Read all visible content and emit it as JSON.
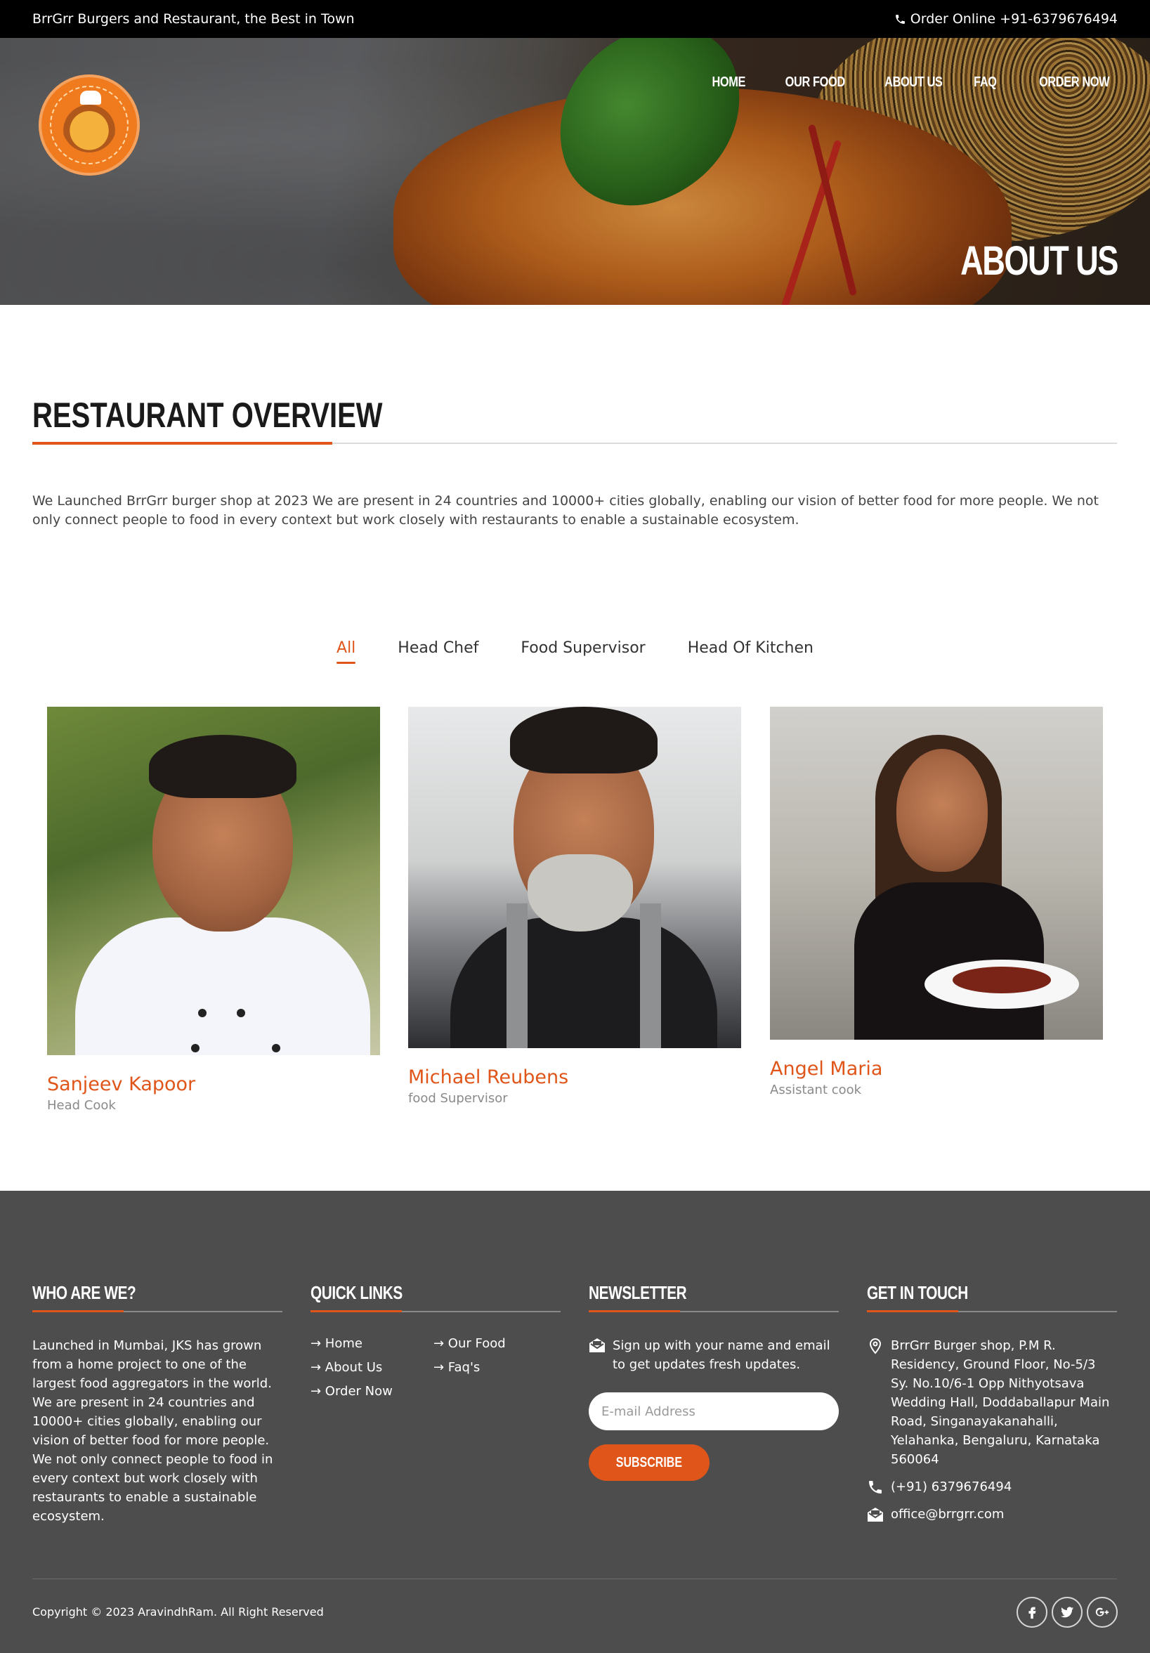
{
  "topbar": {
    "tagline": "BrrGrr Burgers and Restaurant, the Best in Town",
    "order_label": "Order Online +91-6379676494"
  },
  "nav": {
    "items": [
      "HOME",
      "OUR FOOD",
      "ABOUT US",
      "FAQ",
      "ORDER NOW"
    ]
  },
  "hero": {
    "title": "ABOUT US"
  },
  "overview": {
    "title": "RESTAURANT OVERVIEW",
    "text": "We Launched BrrGrr burger shop at 2023 We are present in 24 countries and 10000+ cities globally, enabling our vision of better food for more people. We not only connect people to food in every context but work closely with restaurants to enable a sustainable ecosystem."
  },
  "filters": {
    "items": [
      "All",
      "Head Chef",
      "Food Supervisor",
      "Head Of Kitchen"
    ],
    "active": "All"
  },
  "team": [
    {
      "name": "Sanjeev Kapoor",
      "role": "Head Cook"
    },
    {
      "name": "Michael Reubens",
      "role": "food Supervisor"
    },
    {
      "name": "Angel Maria",
      "role": "Assistant cook"
    }
  ],
  "footer": {
    "who": {
      "title": "WHO ARE WE?",
      "text": "Launched in Mumbai, JKS has grown from a home project to one of the largest food aggregators in the world. We are present in 24 countries and 10000+ cities globally, enabling our vision of better food for more people. We not only connect people to food in every context but work closely with restaurants to enable a sustainable ecosystem."
    },
    "quick_links": {
      "title": "QUICK LINKS",
      "items": [
        "→ Home",
        "→ Our Food",
        "→ About Us",
        "→ Faq's",
        "→ Order Now"
      ]
    },
    "newsletter": {
      "title": "NEWSLETTER",
      "text": "Sign up with your name and email to get updates fresh updates.",
      "placeholder": "E-mail Address",
      "button": "SUBSCRIBE"
    },
    "contact": {
      "title": "GET IN TOUCH",
      "address": "BrrGrr Burger shop, P.M R. Residency, Ground Floor, No-5/3 Sy. No.10/6-1 Opp Nithyotsava Wedding Hall, Doddaballapur Main Road, Singanayakanahalli, Yelahanka, Bengaluru, Karnataka 560064",
      "phone": "(+91) 6379676494",
      "email": "office@brrgrr.com"
    },
    "copyright": "Copyright © 2023 AravindhRam. All Right Reserved",
    "socials": [
      "facebook-icon",
      "twitter-icon",
      "google-plus-icon"
    ]
  },
  "colors": {
    "accent": "#e0561a",
    "footer_bg": "#4d4d4d",
    "topbar_bg": "#000000"
  }
}
